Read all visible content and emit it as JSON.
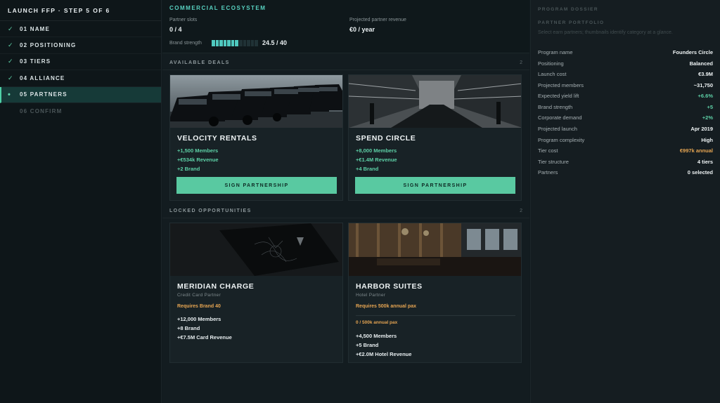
{
  "sidebar": {
    "header": "LAUNCH FFP · STEP 5 OF 6",
    "steps": [
      {
        "mark": "✓",
        "label": "01 NAME"
      },
      {
        "mark": "✓",
        "label": "02 POSITIONING"
      },
      {
        "mark": "✓",
        "label": "03 TIERS"
      },
      {
        "mark": "✓",
        "label": "04 ALLIANCE"
      },
      {
        "mark": "•",
        "label": "05 PARTNERS"
      },
      {
        "mark": "",
        "label": "06 CONFIRM"
      }
    ]
  },
  "ecosystem": {
    "title": "COMMERCIAL ECOSYSTEM",
    "slots_label": "Partner slots",
    "slots_value": "0 / 4",
    "revenue_label": "Projected partner revenue",
    "revenue_value": "€0 / year",
    "brand_label": "Brand strength",
    "brand_value": "24.5 / 40",
    "brand_fraction": 0.6125
  },
  "available": {
    "header": "AVAILABLE DEALS",
    "count": "2",
    "deals": [
      {
        "title": "VELOCITY RENTALS",
        "lines": [
          "+1,500 Members",
          "+€534k Revenue",
          "+2 Brand"
        ],
        "button": "SIGN PARTNERSHIP"
      },
      {
        "title": "SPEND CIRCLE",
        "lines": [
          "+8,000 Members",
          "+€1.4M Revenue",
          "+4 Brand"
        ],
        "button": "SIGN PARTNERSHIP"
      }
    ]
  },
  "locked": {
    "header": "LOCKED OPPORTUNITIES",
    "count": "2",
    "deals": [
      {
        "title": "MERIDIAN CHARGE",
        "subtitle": "Credit Card Partner",
        "requirement": "Requires Brand 40",
        "lines": [
          "+12,000 Members",
          "+8 Brand",
          "+€7.5M Card Revenue"
        ]
      },
      {
        "title": "HARBOR SUITES",
        "subtitle": "Hotel Partner",
        "requirement": "Requires 500k annual pax",
        "progress": "0 / 500k annual pax",
        "lines": [
          "+4,500 Members",
          "+5 Brand",
          "+€2.0M Hotel Revenue"
        ]
      }
    ]
  },
  "dossier": {
    "header": "PROGRAM DOSSIER",
    "portfolio_header": "PARTNER PORTFOLIO",
    "portfolio_help": "Select earn partners; thumbnails identify category at a glance.",
    "rows": [
      {
        "key": "Program name",
        "value": "Founders Circle"
      },
      {
        "key": "Positioning",
        "value": "Balanced"
      },
      {
        "key": "Launch cost",
        "value": "€3.9M"
      },
      {
        "key": "Projected members",
        "value": "~31,750"
      },
      {
        "key": "Expected yield lift",
        "value": "+6.6%"
      },
      {
        "key": "Brand strength",
        "value": "+5"
      },
      {
        "key": "Corporate demand",
        "value": "+2%"
      },
      {
        "key": "Projected launch",
        "value": "Apr 2019"
      },
      {
        "key": "Program complexity",
        "value": "High"
      },
      {
        "key": "Tier cost",
        "value": "€997k annual"
      },
      {
        "key": "Tier structure",
        "value": "4 tiers"
      },
      {
        "key": "Partners",
        "value": "0 selected"
      }
    ]
  },
  "colors": {
    "accent": "#58d2c1",
    "positive": "#5dd0a6",
    "warning": "#e6a552",
    "button": "#59c9a1"
  }
}
